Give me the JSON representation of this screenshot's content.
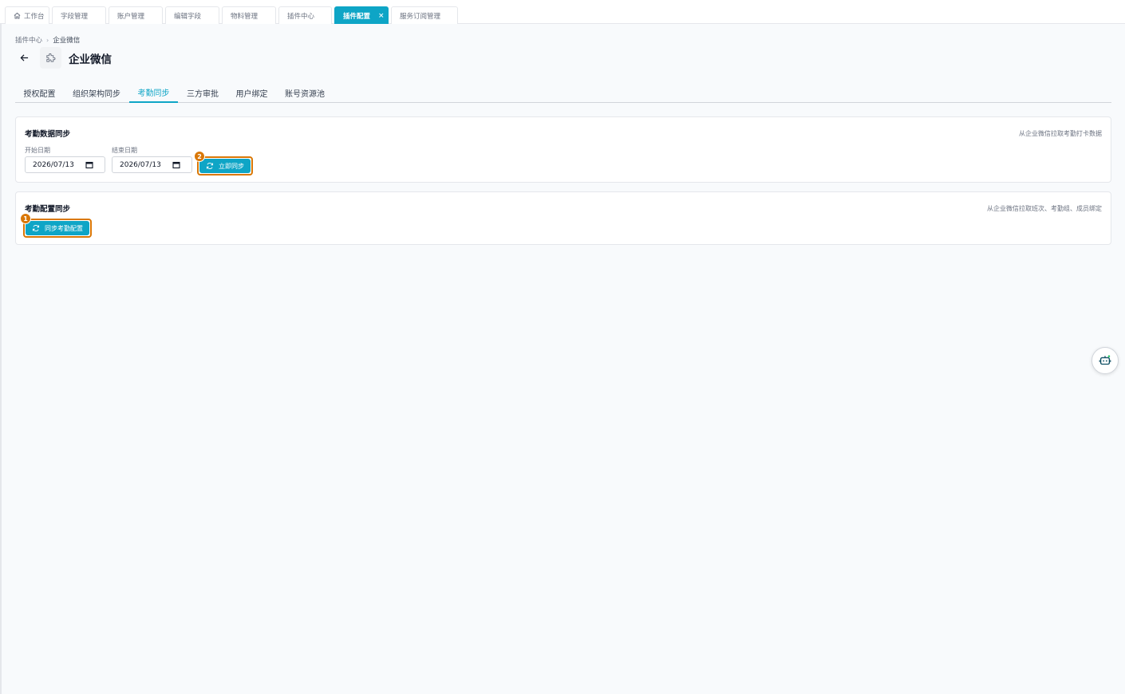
{
  "tabs": [
    {
      "label": "工作台",
      "icon": "home-icon",
      "active": false
    },
    {
      "label": "字段管理",
      "active": false
    },
    {
      "label": "账户管理",
      "active": false
    },
    {
      "label": "编辑字段",
      "active": false
    },
    {
      "label": "物料管理",
      "active": false
    },
    {
      "label": "插件中心",
      "active": false
    },
    {
      "label": "插件配置",
      "active": true,
      "closable": true,
      "close_glyph": "×"
    },
    {
      "label": "服务订阅管理",
      "active": false
    }
  ],
  "breadcrumb": {
    "parent": "插件中心",
    "separator": "›",
    "current": "企业微信"
  },
  "page": {
    "title": "企业微信",
    "back_icon": "arrow-left-icon",
    "plugin_icon": "puzzle-icon"
  },
  "subtabs": [
    {
      "label": "授权配置",
      "active": false
    },
    {
      "label": "组织架构同步",
      "active": false
    },
    {
      "label": "考勤同步",
      "active": true
    },
    {
      "label": "三方审批",
      "active": false
    },
    {
      "label": "用户绑定",
      "active": false
    },
    {
      "label": "账号资源池",
      "active": false
    }
  ],
  "attendance_data": {
    "title": "考勤数据同步",
    "description": "从企业微信拉取考勤打卡数据",
    "start_label": "开始日期",
    "start_value": "2026/07/13",
    "end_label": "结束日期",
    "end_value": "2026/07/13",
    "button_label": "立即同步",
    "marker": "2"
  },
  "attendance_config": {
    "title": "考勤配置同步",
    "description": "从企业微信拉取班次、考勤组、成员绑定",
    "button_label": "同步考勤配置",
    "marker": "1"
  },
  "colors": {
    "accent": "#0ea5c6",
    "highlight": "#d97706"
  },
  "floating": {
    "icon": "robot-icon"
  }
}
